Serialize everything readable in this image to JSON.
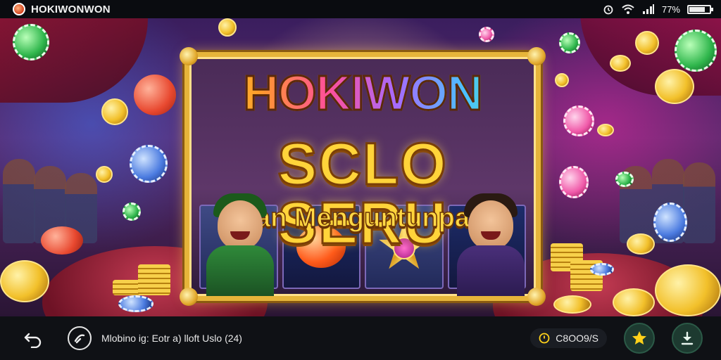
{
  "status_bar": {
    "app_name": "HOKIWONWON",
    "battery_text": "77%",
    "battery_level": 0.77,
    "icons": [
      "app-logo-icon",
      "alarm-icon",
      "wifi-icon",
      "signal-icon",
      "battery-icon"
    ]
  },
  "banner": {
    "title_line1": "HOKIWON",
    "title_line2": "SCLO SERU",
    "title_line3": "dan Menguntunpan"
  },
  "bottom_bar": {
    "label": "Mlobino ig: Eotr a) lloft Uslo (24)",
    "timer_text": "C8OO9/S",
    "icons": [
      "back-arrow-icon",
      "game-controller-icon",
      "clock-icon",
      "star-icon",
      "download-icon"
    ]
  },
  "colors": {
    "status_bar_bg": "#0a0c10",
    "bottom_bar_bg": "#0f1115",
    "frame_gold": "#e6b43a",
    "title_yellow": "#ffd43a",
    "star_yellow": "#ffd21a",
    "button_green": "#1d3a30"
  }
}
